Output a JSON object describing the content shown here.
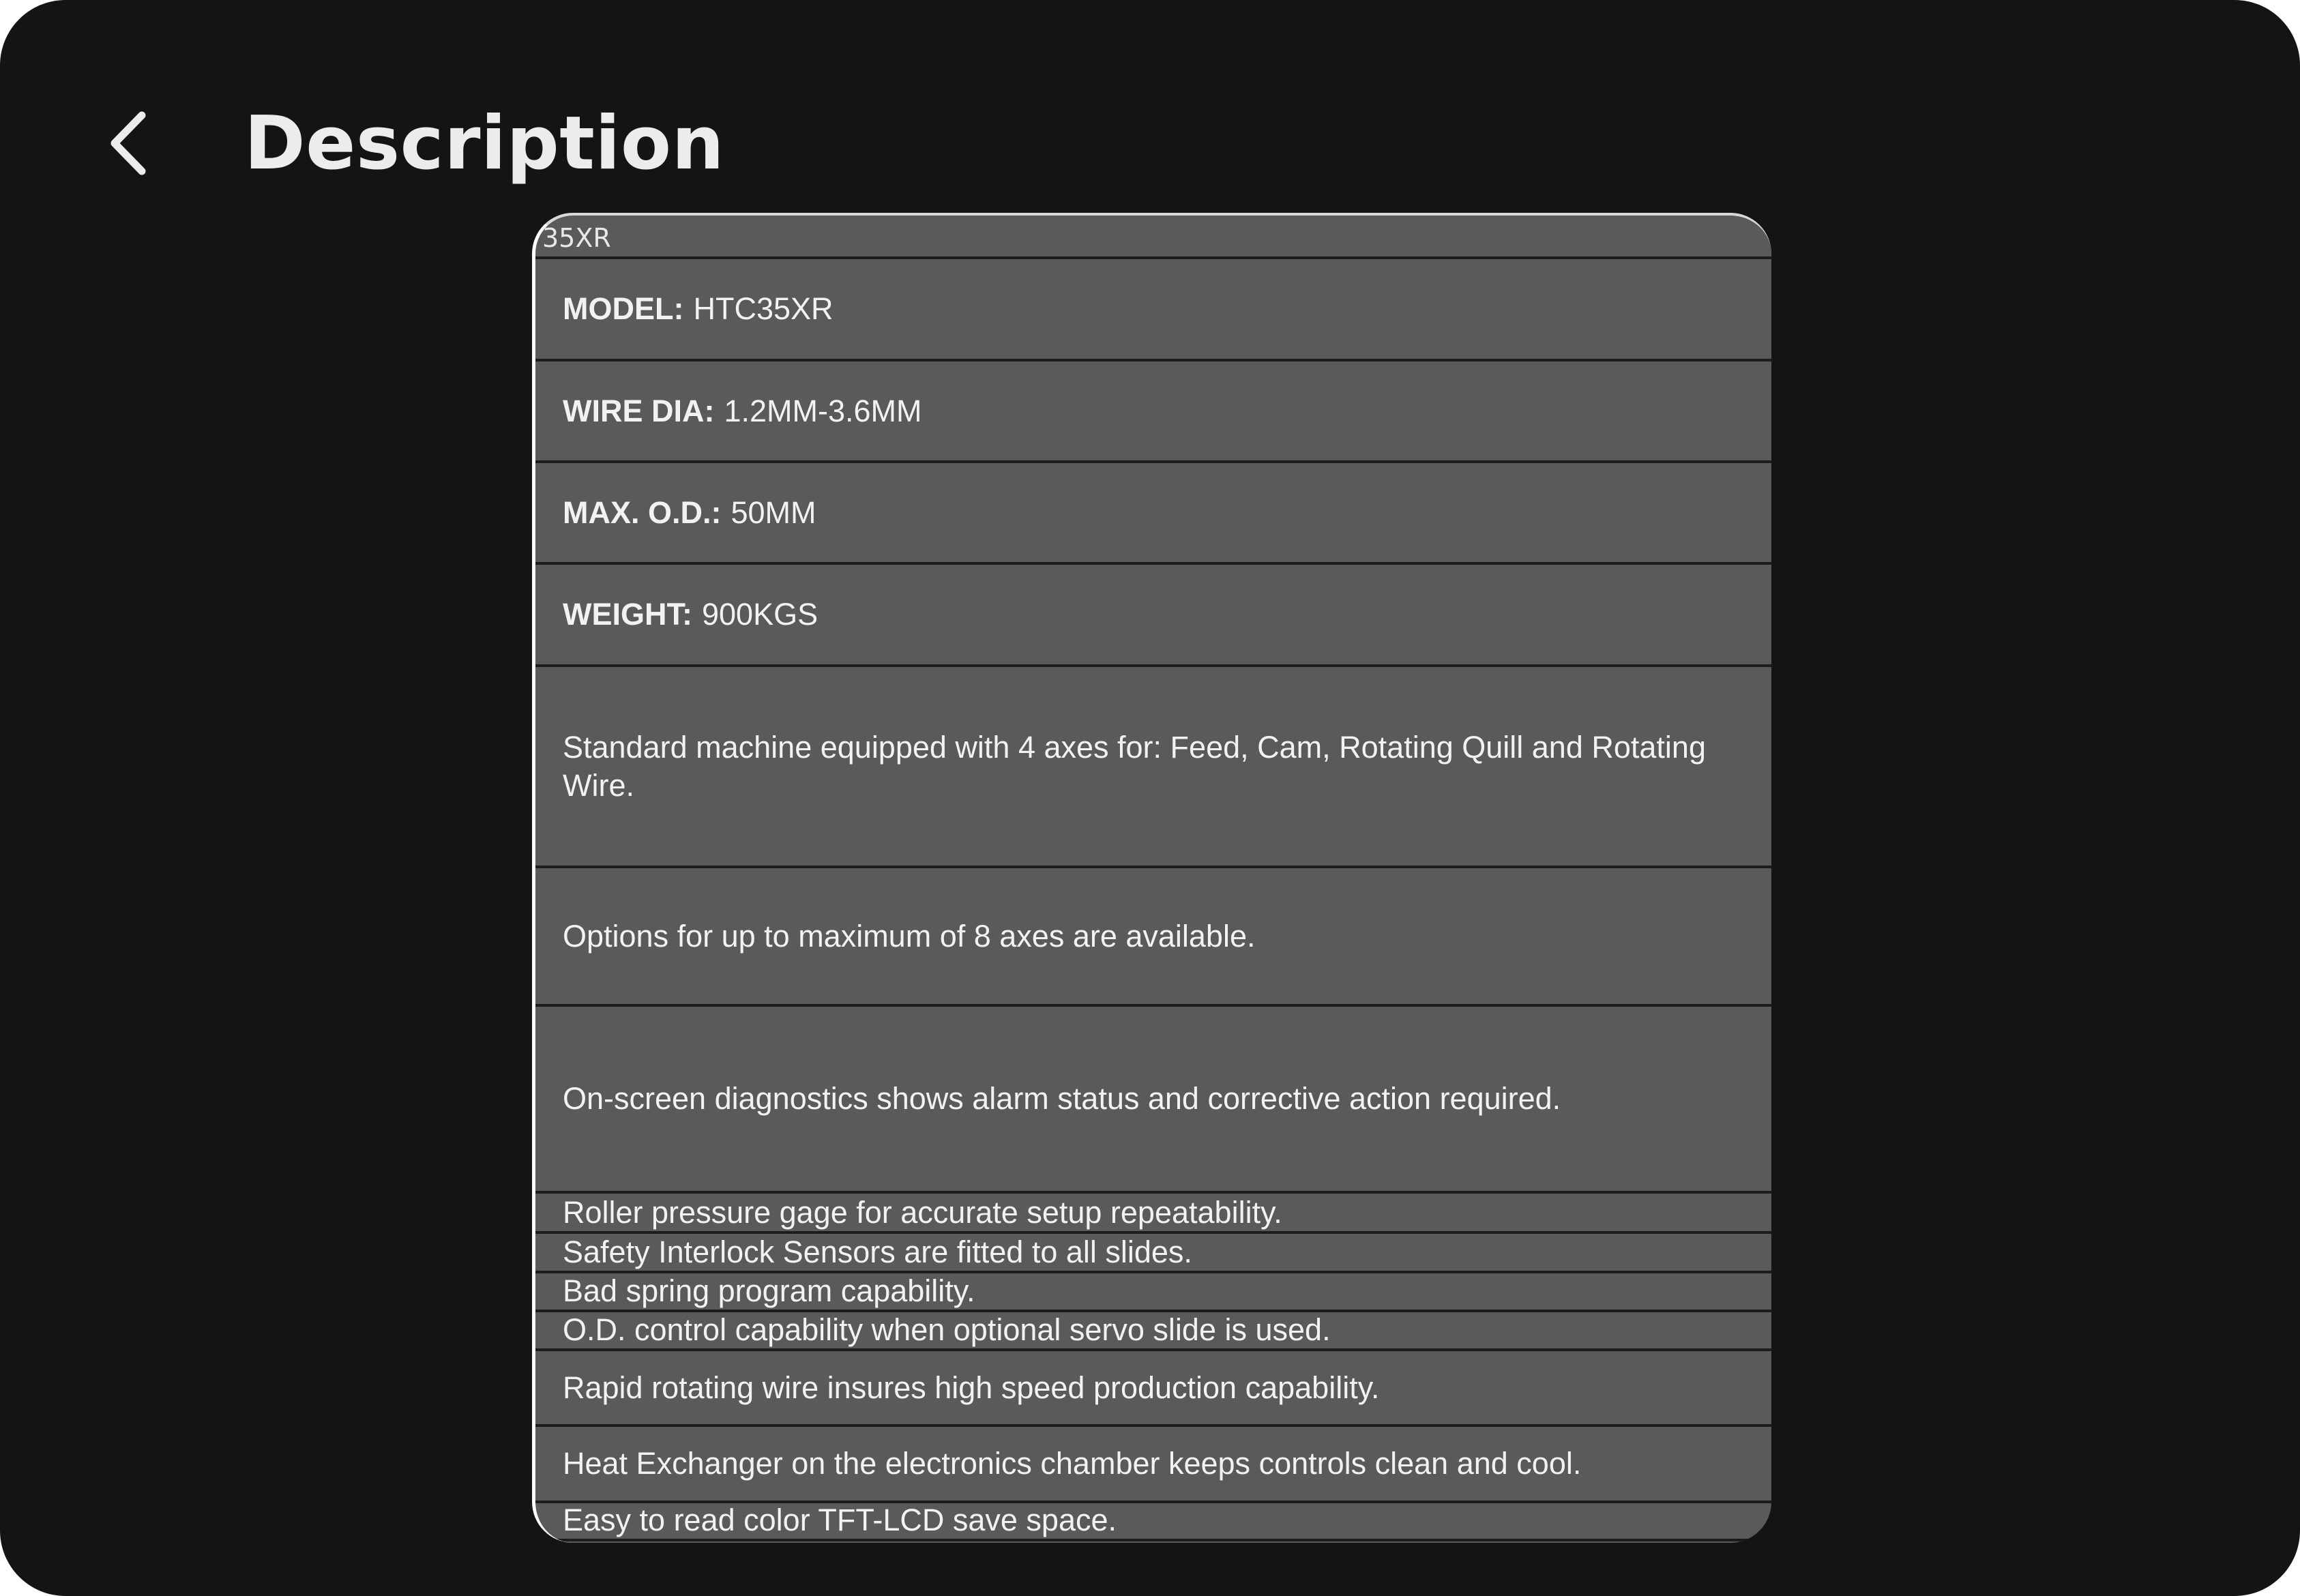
{
  "header": {
    "title": "Description",
    "back_icon": "chevron-left-icon"
  },
  "document": {
    "caption": "35XR",
    "specs": [
      {
        "label": "MODEL:",
        "value": "HTC35XR"
      },
      {
        "label": "WIRE DIA:",
        "value": "1.2MM-3.6MM"
      },
      {
        "label": "MAX. O.D.:",
        "value": "50MM"
      },
      {
        "label": "WEIGHT:",
        "value": "900KGS"
      }
    ],
    "features": [
      "Standard machine equipped with 4 axes for: Feed, Cam, Rotating Quill and Rotating Wire.",
      "Options for up to maximum of 8 axes are available.",
      "On-screen diagnostics shows alarm status and corrective action required.",
      "Roller pressure gage for accurate setup repeatability.",
      "Safety Interlock Sensors are fitted to all slides.",
      "Bad spring program capability.",
      "O.D. control capability when optional servo slide is used.",
      "Rapid rotating wire insures high speed production capability.",
      "Heat Exchanger on the electronics chamber keeps controls clean and cool.",
      "Easy to read color TFT-LCD save space."
    ]
  },
  "colors": {
    "background": "#141414",
    "panel": "#5a5a5a",
    "text": "#f2f2f2",
    "title": "#ececec"
  }
}
